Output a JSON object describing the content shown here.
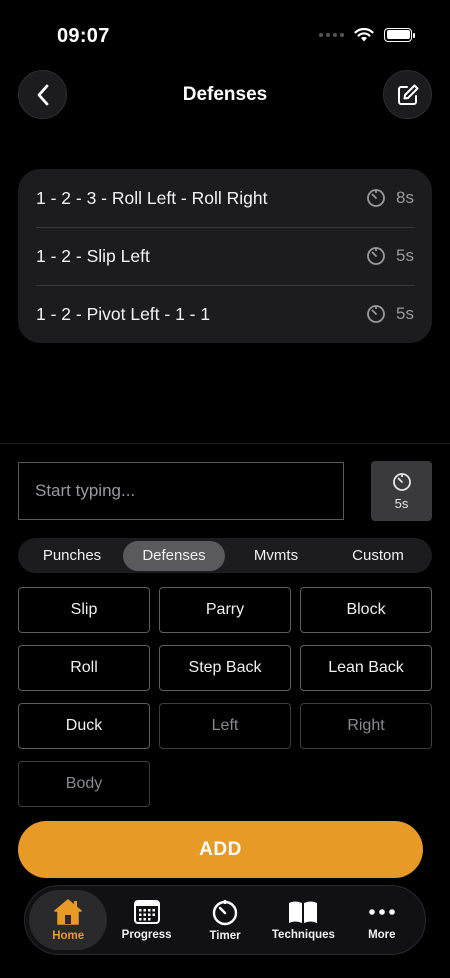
{
  "status_bar": {
    "time": "09:07"
  },
  "header": {
    "title": "Defenses"
  },
  "combos": [
    {
      "text": "1 - 2 - 3 - Roll Left - Roll Right",
      "duration": "8s"
    },
    {
      "text": "1 - 2 - Slip Left",
      "duration": "5s"
    },
    {
      "text": "1 - 2 - Pivot Left - 1 - 1",
      "duration": "5s"
    }
  ],
  "input": {
    "placeholder": "Start typing...",
    "value": ""
  },
  "timer": {
    "label": "5s"
  },
  "segments": [
    {
      "label": "Punches",
      "active": false
    },
    {
      "label": "Defenses",
      "active": true
    },
    {
      "label": "Mvmts",
      "active": false
    },
    {
      "label": "Custom",
      "active": false
    }
  ],
  "chips": [
    {
      "label": "Slip",
      "dim": false
    },
    {
      "label": "Parry",
      "dim": false
    },
    {
      "label": "Block",
      "dim": false
    },
    {
      "label": "Roll",
      "dim": false
    },
    {
      "label": "Step Back",
      "dim": false
    },
    {
      "label": "Lean Back",
      "dim": false
    },
    {
      "label": "Duck",
      "dim": false
    },
    {
      "label": "Left",
      "dim": true
    },
    {
      "label": "Right",
      "dim": true
    },
    {
      "label": "Body",
      "dim": true
    }
  ],
  "add_button": {
    "label": "ADD"
  },
  "tabs": [
    {
      "label": "Home",
      "icon": "home-icon",
      "active": true
    },
    {
      "label": "Progress",
      "icon": "calendar-icon",
      "active": false
    },
    {
      "label": "Timer",
      "icon": "timer-icon",
      "active": false
    },
    {
      "label": "Techniques",
      "icon": "book-icon",
      "active": false
    },
    {
      "label": "More",
      "icon": "more-icon",
      "active": false
    }
  ],
  "colors": {
    "accent": "#e89a27",
    "card": "#1c1c1e",
    "background": "#000000"
  }
}
